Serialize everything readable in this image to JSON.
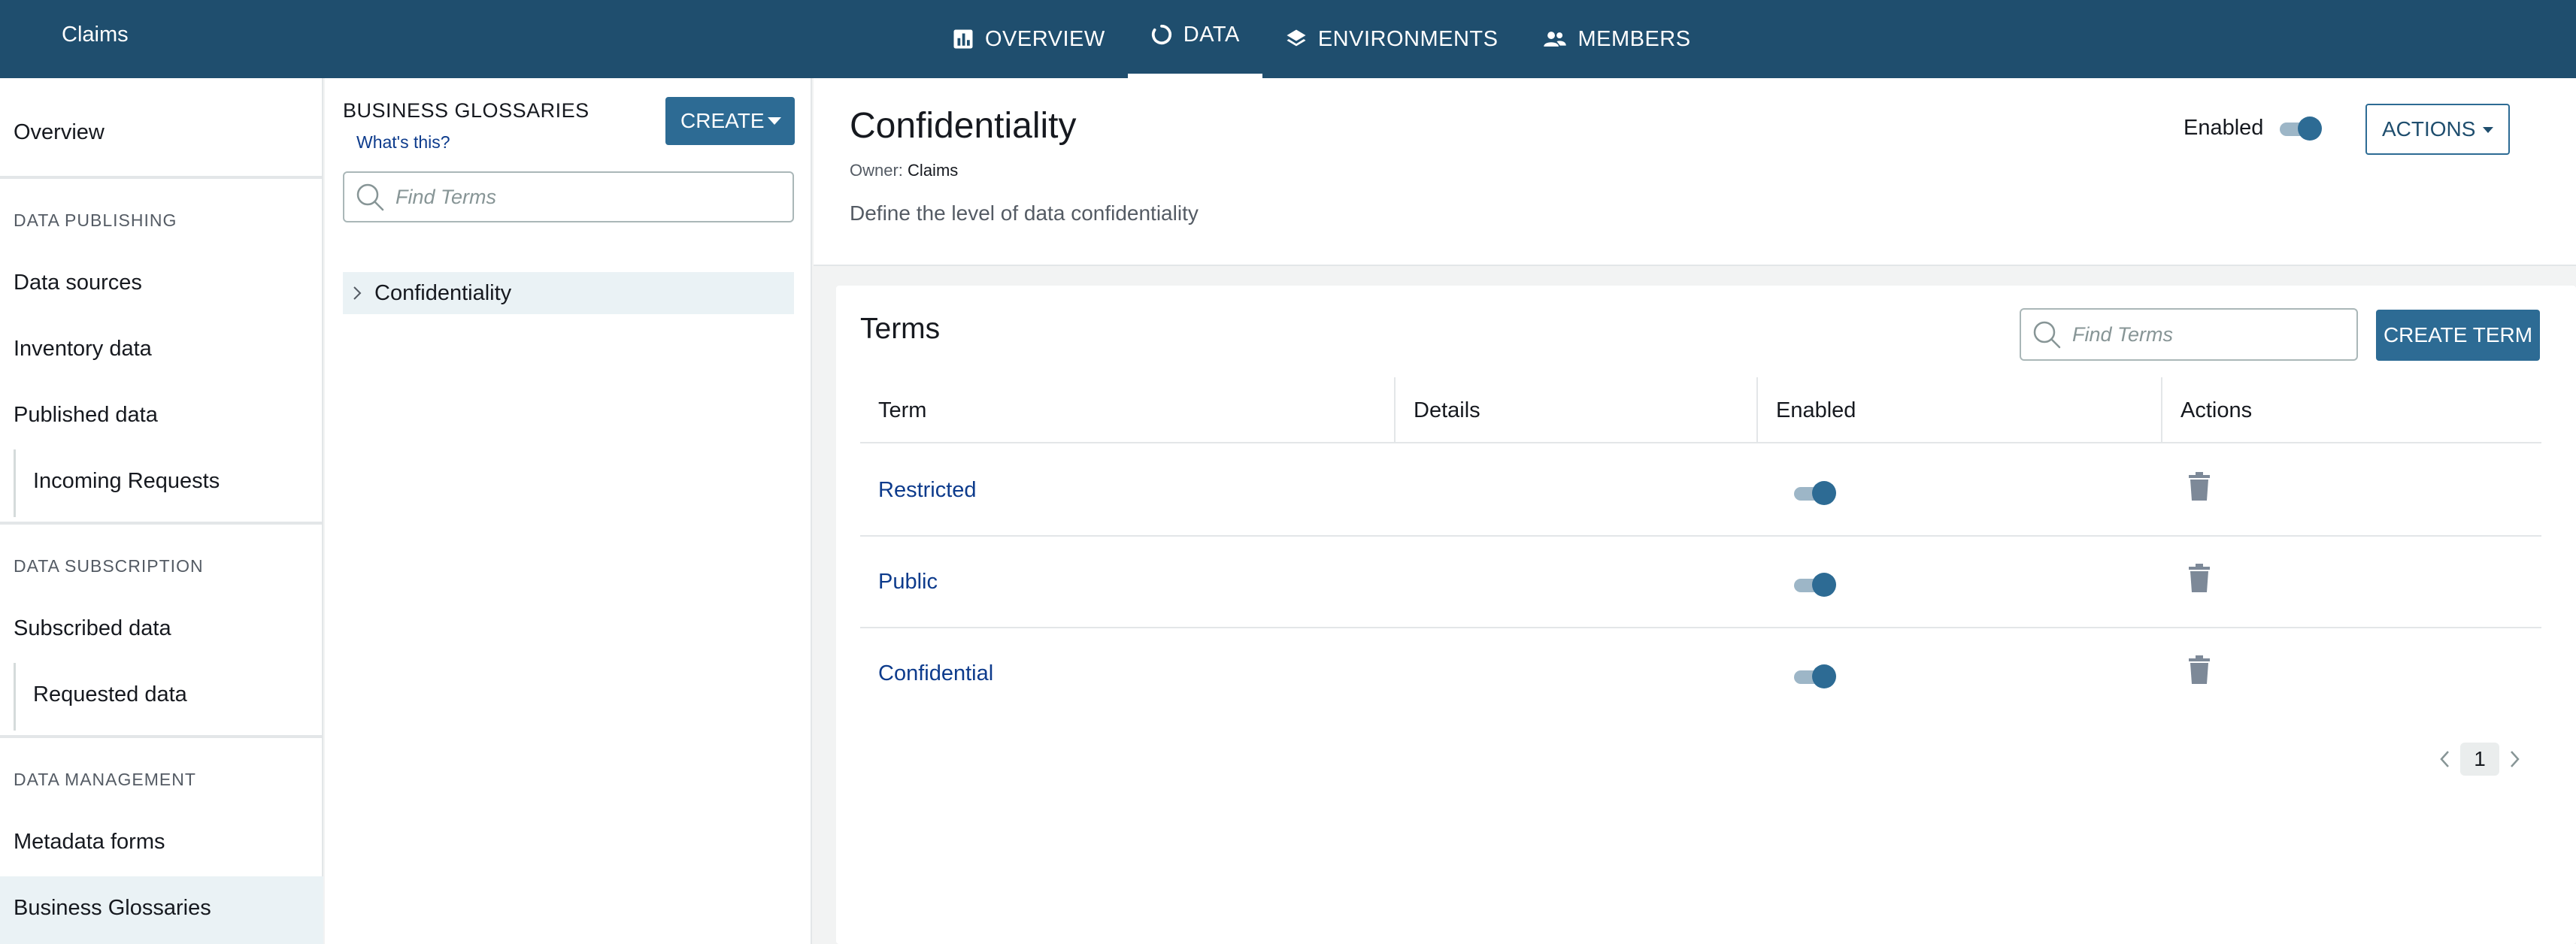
{
  "app": {
    "name": "Claims"
  },
  "topnav": {
    "tabs": [
      {
        "label": "OVERVIEW",
        "icon": "bar-chart-icon"
      },
      {
        "label": "DATA",
        "icon": "circle-progress-icon",
        "active": true
      },
      {
        "label": "ENVIRONMENTS",
        "icon": "layers-icon"
      },
      {
        "label": "MEMBERS",
        "icon": "people-icon"
      }
    ]
  },
  "sidebar": {
    "overview": "Overview",
    "sections": {
      "publishing": "DATA PUBLISHING",
      "subscription": "DATA SUBSCRIPTION",
      "management": "DATA MANAGEMENT"
    },
    "items": {
      "data_sources": "Data sources",
      "inventory_data": "Inventory data",
      "published_data": "Published data",
      "incoming_requests": "Incoming Requests",
      "subscribed_data": "Subscribed data",
      "requested_data": "Requested data",
      "metadata_forms": "Metadata forms",
      "business_glossaries": "Business Glossaries"
    },
    "active": "business_glossaries"
  },
  "glossary_panel": {
    "title": "BUSINESS GLOSSARIES",
    "help_link": "What's this?",
    "create_label": "CREATE",
    "search_placeholder": "Find Terms",
    "tree": [
      {
        "label": "Confidentiality"
      }
    ]
  },
  "detail": {
    "title": "Confidentiality",
    "owner_label": "Owner:",
    "owner_value": "Claims",
    "description": "Define the level of data confidentiality",
    "enabled_label": "Enabled",
    "enabled": true,
    "actions_label": "ACTIONS"
  },
  "terms": {
    "title": "Terms",
    "search_placeholder": "Find Terms",
    "create_label": "CREATE TERM",
    "columns": [
      "Term",
      "Details",
      "Enabled",
      "Actions"
    ],
    "rows": [
      {
        "term": "Restricted",
        "details": "",
        "enabled": true
      },
      {
        "term": "Public",
        "details": "",
        "enabled": true
      },
      {
        "term": "Confidential",
        "details": "",
        "enabled": true
      }
    ],
    "pagination": {
      "current_page": "1"
    }
  },
  "colors": {
    "topbar": "#1f4e6e",
    "primary_button": "#2d6b94",
    "link": "#0d3b8c",
    "active_bg": "#eaf2f5"
  }
}
